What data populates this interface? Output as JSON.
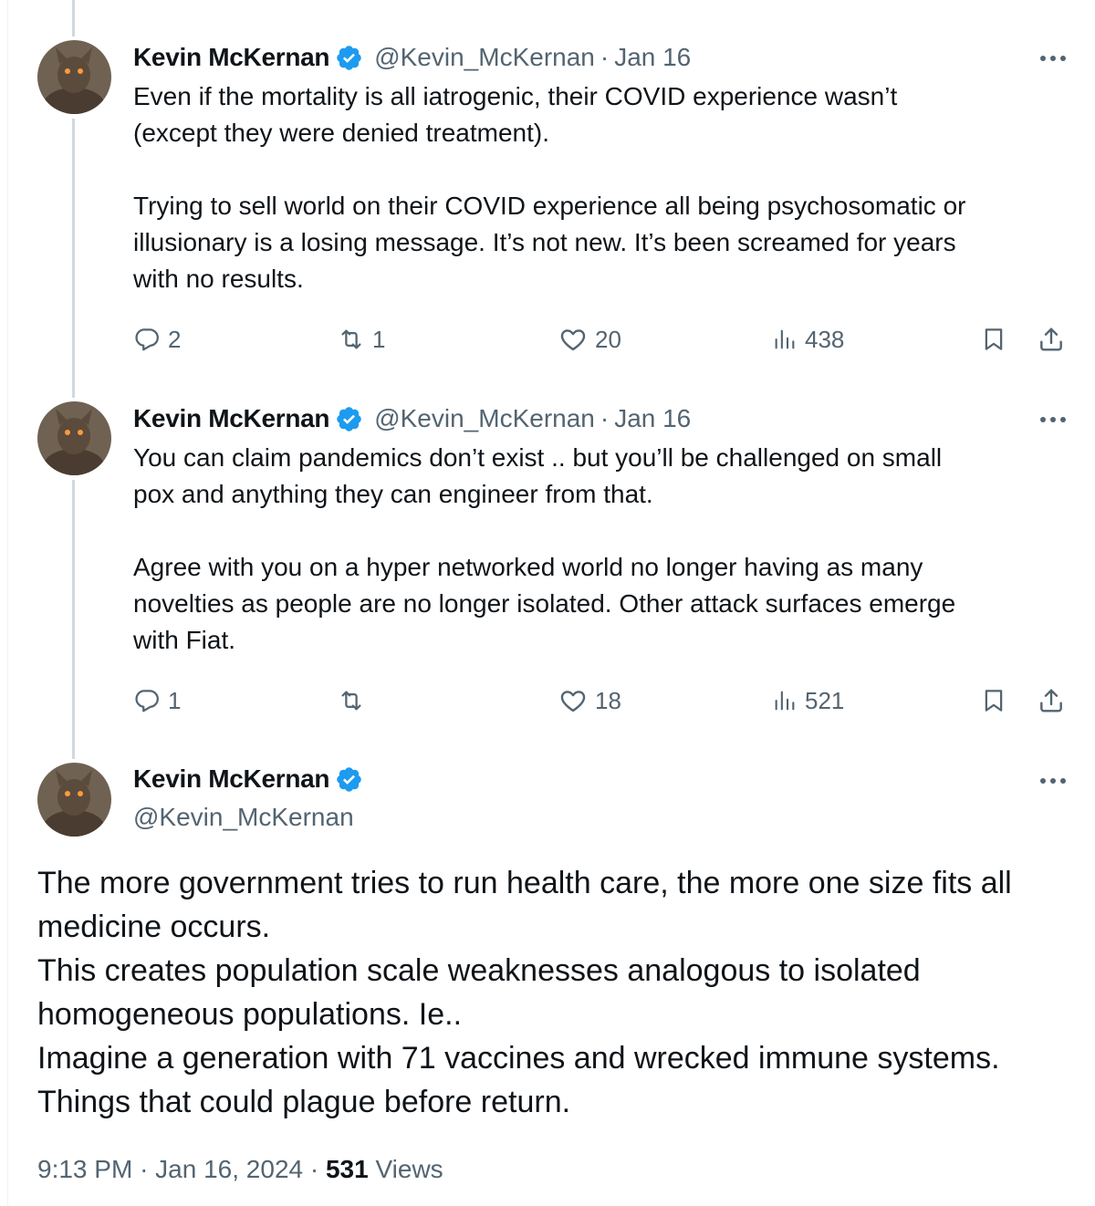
{
  "author": {
    "name": "Kevin McKernan",
    "handle": "@Kevin_McKernan"
  },
  "colors": {
    "verified_badge": "#1d9bf0",
    "secondary_text": "#536471",
    "thread_line": "#cfd9de"
  },
  "replies": [
    {
      "date": "Jan 16",
      "separator": "·",
      "text": "Even if the mortality is all iatrogenic, their COVID experience wasn’t\n(except they were denied treatment).\n\nTrying to sell world on their COVID experience all being psychosomatic or\nillusionary is a losing message. It’s not new. It’s been screamed for years\nwith no results.",
      "reply_count": "2",
      "repost_count": "1",
      "like_count": "20",
      "view_count": "438"
    },
    {
      "date": "Jan 16",
      "separator": "·",
      "text": "You can claim pandemics don’t exist .. but you’ll be challenged on small\npox and anything they can engineer from that.\n\nAgree with you on a hyper networked world no longer having as many\nnovelties as people are no longer isolated. Other attack surfaces emerge\nwith Fiat.",
      "reply_count": "1",
      "repost_count": "",
      "like_count": "18",
      "view_count": "521"
    }
  ],
  "main_tweet": {
    "text": "The more government tries to run health care, the more one size fits all\nmedicine occurs.\nThis creates population scale weaknesses analogous to isolated\nhomogeneous populations. Ie..\nImagine a generation with 71 vaccines and wrecked immune systems.\nThings that could plague before return.",
    "time": "9:13 PM",
    "date": "Jan 16, 2024",
    "separator": "·",
    "views_count": "531",
    "views_label": "Views"
  },
  "icons": {
    "more": "more-dots-icon",
    "reply": "reply-icon",
    "repost": "repost-icon",
    "like": "like-icon",
    "views": "views-icon",
    "bookmark": "bookmark-icon",
    "share": "share-icon",
    "verified": "verified-badge-icon"
  }
}
